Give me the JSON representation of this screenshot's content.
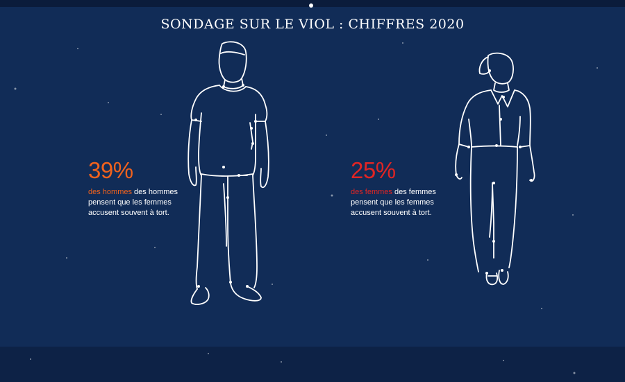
{
  "title": "SONDAGE SUR LE VIOL : CHIFFRES 2020",
  "stats": {
    "men": {
      "percent": "39%",
      "highlight": "des hommes",
      "text_after_highlight": " des hommes pensent que les femmes accusent souvent à tort."
    },
    "women": {
      "percent": "25%",
      "highlight": "des femmes",
      "text_after_highlight": " des femmes pensent que les femmes accusent souvent à tort."
    }
  },
  "colors": {
    "background": "#112c57",
    "men_accent": "#f1621d",
    "women_accent": "#e12524",
    "text": "#ffffff"
  },
  "figures": [
    "man-outline-illustration",
    "woman-outline-illustration"
  ]
}
